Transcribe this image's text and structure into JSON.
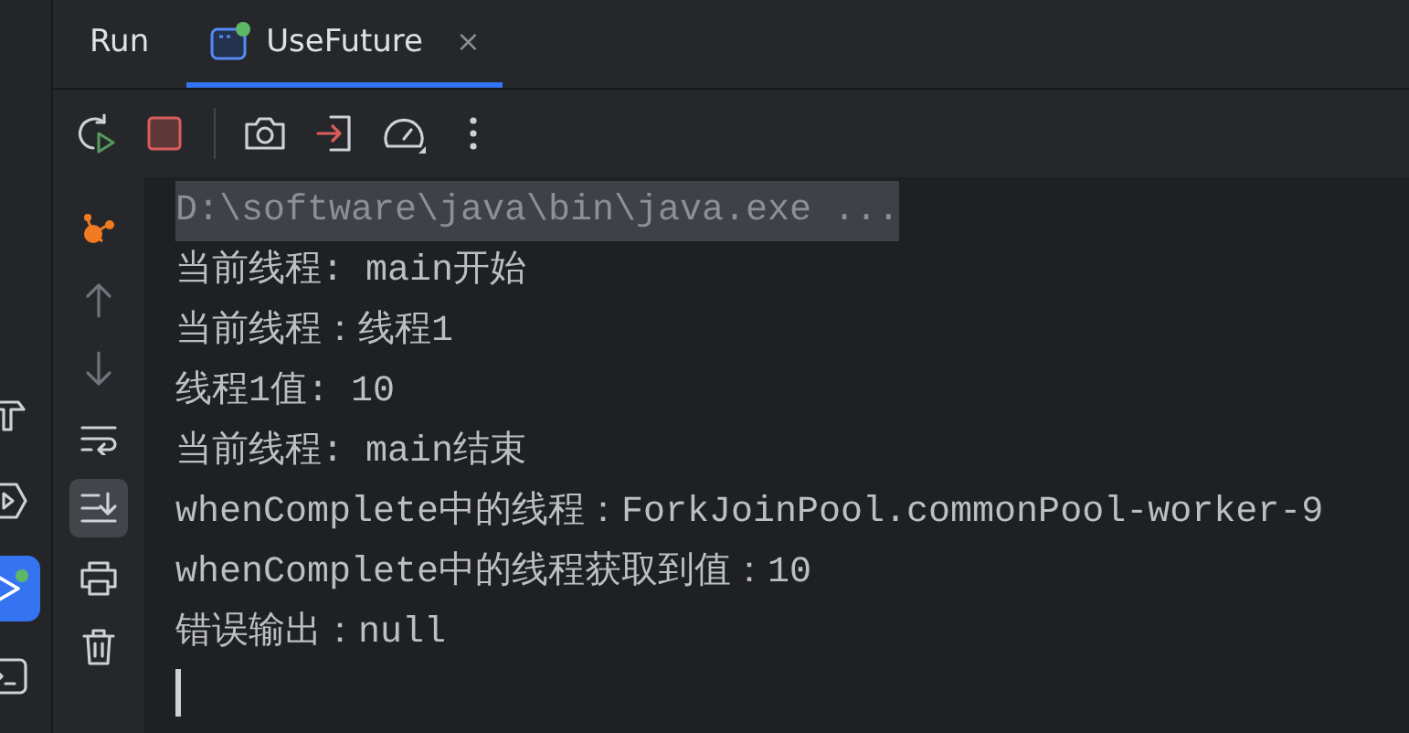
{
  "tabs": [
    {
      "label": "Run",
      "kind": "title",
      "selected": false
    },
    {
      "label": "UseFuture",
      "kind": "config",
      "selected": true,
      "running": true,
      "close": "×"
    }
  ],
  "toolbar": [
    {
      "kind": "rerun"
    },
    {
      "kind": "stop"
    },
    {
      "kind": "divider"
    },
    {
      "kind": "camera"
    },
    {
      "kind": "exit"
    },
    {
      "kind": "gauge"
    },
    {
      "kind": "more"
    }
  ],
  "tool_strip": [
    {
      "kind": "build",
      "selected": false,
      "running": false
    },
    {
      "kind": "services",
      "selected": false,
      "running": false
    },
    {
      "kind": "run",
      "selected": true,
      "running": true
    },
    {
      "kind": "terminal",
      "selected": false,
      "running": false
    }
  ],
  "console_actions": [
    {
      "kind": "spring",
      "selected": false
    },
    {
      "kind": "up",
      "selected": false
    },
    {
      "kind": "down",
      "selected": false
    },
    {
      "kind": "wrap",
      "selected": false
    },
    {
      "kind": "scroll-end",
      "selected": true
    },
    {
      "kind": "print",
      "selected": false
    },
    {
      "kind": "trash",
      "selected": false
    }
  ],
  "console": {
    "lines": [
      {
        "kind": "command",
        "text": "D:\\software\\java\\bin\\java.exe ..."
      },
      {
        "kind": "output",
        "text": "当前线程: main开始"
      },
      {
        "kind": "output",
        "text": "当前线程：线程1"
      },
      {
        "kind": "output",
        "text": "线程1值: 10"
      },
      {
        "kind": "output",
        "text": "当前线程: main结束"
      },
      {
        "kind": "output",
        "text": "whenComplete中的线程：ForkJoinPool.commonPool-worker-9"
      },
      {
        "kind": "output",
        "text": "whenComplete中的线程获取到值：10"
      },
      {
        "kind": "output",
        "text": "错误输出：null"
      }
    ],
    "cursor": true
  }
}
